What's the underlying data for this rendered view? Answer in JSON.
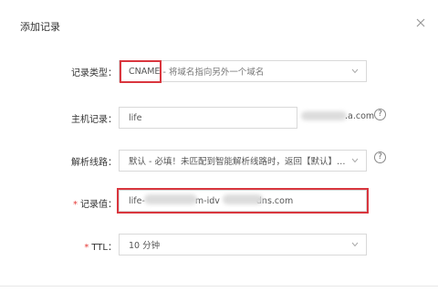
{
  "dialog": {
    "title": "添加记录"
  },
  "form": {
    "record_type": {
      "label": "记录类型：",
      "value_code": "CNAME",
      "value_desc": "- 将域名指向另外一个域名"
    },
    "host_record": {
      "label": "主机记录：",
      "value": "life",
      "suffix": ".a.com"
    },
    "resolve_line": {
      "label": "解析线路：",
      "value": "默认 - 必填！未匹配到智能解析线路时，返回【默认】线路设..."
    },
    "record_value": {
      "required_mark": "*",
      "label": "记录值：",
      "value_prefix": "life-",
      "value_middle": "m-idv",
      "value_suffix": "dns.com"
    },
    "ttl": {
      "required_mark": "*",
      "label": "TTL：",
      "value": "10 分钟"
    },
    "help_glyph": "?"
  },
  "icons": {
    "close": "close-icon",
    "dropdown": "chevron-down-icon",
    "help": "question-circle-icon"
  },
  "colors": {
    "highlight": "#d9363e",
    "required": "#e53935",
    "border": "#d9d9d9"
  }
}
